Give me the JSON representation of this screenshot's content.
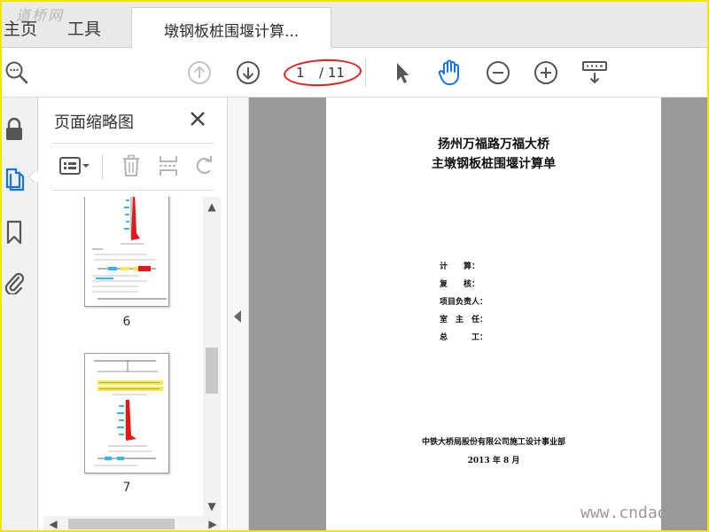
{
  "watermark_logo": "道桥网",
  "tabs": {
    "home": "主页",
    "tools": "工具",
    "document": "墩钢板桩围堰计算..."
  },
  "toolbar": {
    "page_current": "1",
    "page_total": "/ 11",
    "icons": [
      "search-icon",
      "page-up-icon",
      "page-down-icon",
      "select-arrow-icon",
      "hand-tool-icon",
      "zoom-out-icon",
      "zoom-in-icon",
      "keyboard-icon"
    ]
  },
  "rail": {
    "icons": [
      "lock-icon",
      "page-thumbnails-icon",
      "bookmark-icon",
      "attachment-icon"
    ]
  },
  "panel": {
    "title": "页面缩略图",
    "thumbnails": [
      {
        "label": "6"
      },
      {
        "label": "7"
      }
    ]
  },
  "document": {
    "title_line1": "扬州万福路万福大桥",
    "title_line2": "主墩钢板桩围堰计算单",
    "signatures": [
      {
        "label": "计　　算："
      },
      {
        "label": "复　　核："
      },
      {
        "label": "项目负责人："
      },
      {
        "label": "室　主　任："
      },
      {
        "label": "总　　　工："
      }
    ],
    "org": "中铁大桥局股份有限公司施工设计事业部",
    "date": "2013 年 8 月"
  },
  "site_watermark": "www.cndao",
  "colors": {
    "accent_blue": "#1473e6",
    "annotation_red": "#e02020",
    "frame_yellow": "#f2e600",
    "viewer_gray": "#9a9a9a"
  }
}
